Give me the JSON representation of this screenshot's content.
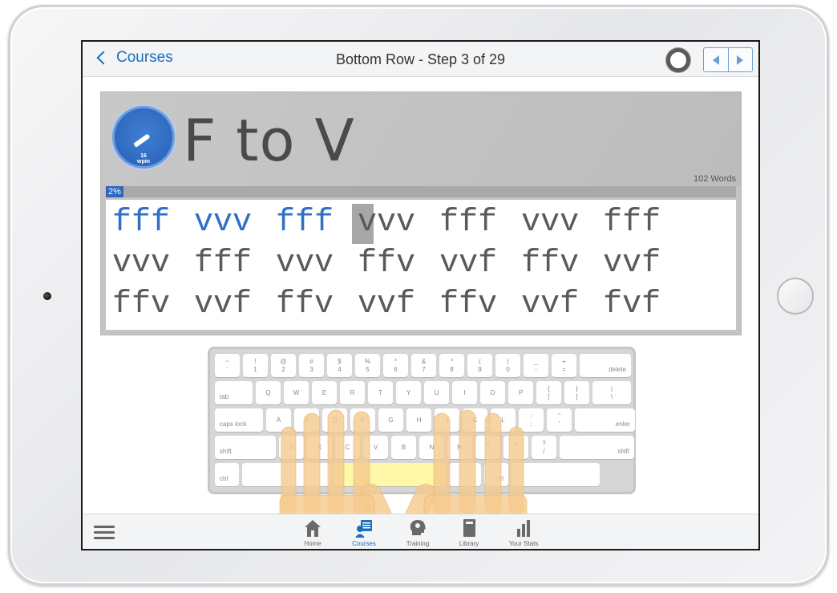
{
  "nav": {
    "back_label": "Courses",
    "title": "Bottom Row - Step 3 of 29"
  },
  "lesson": {
    "title": "F to V",
    "speed_value": "16",
    "speed_unit": "wpm",
    "word_count": "102 Words",
    "progress_label": "2%",
    "progress_fraction": 0.02,
    "lines": [
      [
        "fff",
        "vvv",
        "fff",
        "vvv",
        "fff",
        "vvv",
        "fff"
      ],
      [
        "vvv",
        "fff",
        "vvv",
        "ffv",
        "vvf",
        "ffv",
        "vvf"
      ],
      [
        "ffv",
        "vvf",
        "ffv",
        "vvf",
        "ffv",
        "vvf",
        "fvf"
      ]
    ]
  },
  "keyboard": {
    "rows": [
      [
        [
          "~",
          "`"
        ],
        [
          "!",
          "1"
        ],
        [
          "@",
          "2"
        ],
        [
          "#",
          "3"
        ],
        [
          "$",
          "4"
        ],
        [
          "%",
          "5"
        ],
        [
          "^",
          "6"
        ],
        [
          "&",
          "7"
        ],
        [
          "*",
          "8"
        ],
        [
          "(",
          "9"
        ],
        [
          ")",
          "0"
        ],
        [
          "_",
          "-"
        ],
        [
          "+",
          "="
        ],
        [
          "",
          "delete"
        ]
      ],
      [
        [
          "",
          "tab"
        ],
        [
          "",
          "Q"
        ],
        [
          "",
          "W"
        ],
        [
          "",
          "E"
        ],
        [
          "",
          "R"
        ],
        [
          "",
          "T"
        ],
        [
          "",
          "Y"
        ],
        [
          "",
          "U"
        ],
        [
          "",
          "I"
        ],
        [
          "",
          "O"
        ],
        [
          "",
          "P"
        ],
        [
          "{",
          "["
        ],
        [
          "}",
          "]"
        ],
        [
          "|",
          "\\"
        ]
      ],
      [
        [
          "",
          "caps lock"
        ],
        [
          "",
          "A"
        ],
        [
          "",
          "S"
        ],
        [
          "",
          "D"
        ],
        [
          "",
          "F"
        ],
        [
          "",
          "G"
        ],
        [
          "",
          "H"
        ],
        [
          "",
          "J"
        ],
        [
          "",
          "K"
        ],
        [
          "",
          "L"
        ],
        [
          ":",
          ";"
        ],
        [
          "\"",
          "'"
        ],
        [
          "",
          "enter"
        ]
      ],
      [
        [
          "",
          "shift"
        ],
        [
          "",
          "Z"
        ],
        [
          "",
          "X"
        ],
        [
          "",
          "C"
        ],
        [
          "",
          "V"
        ],
        [
          "",
          "B"
        ],
        [
          "",
          "N"
        ],
        [
          "",
          "M"
        ],
        [
          "<",
          ","
        ],
        [
          ">",
          "."
        ],
        [
          "?",
          "/"
        ],
        [
          "",
          "shift"
        ]
      ],
      [
        [
          "",
          "ctrl"
        ],
        [
          "",
          ""
        ],
        [
          "",
          ""
        ],
        [
          "",
          ""
        ],
        [
          "",
          "ctrl"
        ],
        [
          "",
          ""
        ]
      ]
    ]
  },
  "tabs": [
    {
      "label": "Home",
      "icon": "home-icon"
    },
    {
      "label": "Courses",
      "icon": "courses-icon"
    },
    {
      "label": "Training",
      "icon": "training-icon"
    },
    {
      "label": "Library",
      "icon": "library-icon"
    },
    {
      "label": "Your Stats",
      "icon": "stats-icon"
    }
  ],
  "colors": {
    "accent": "#1a6fc1",
    "typed_text": "#2f6fc4",
    "untyped_text": "#5a5a5a",
    "highlight_key": "#fdf9a8",
    "finger": "#f5c98d"
  }
}
